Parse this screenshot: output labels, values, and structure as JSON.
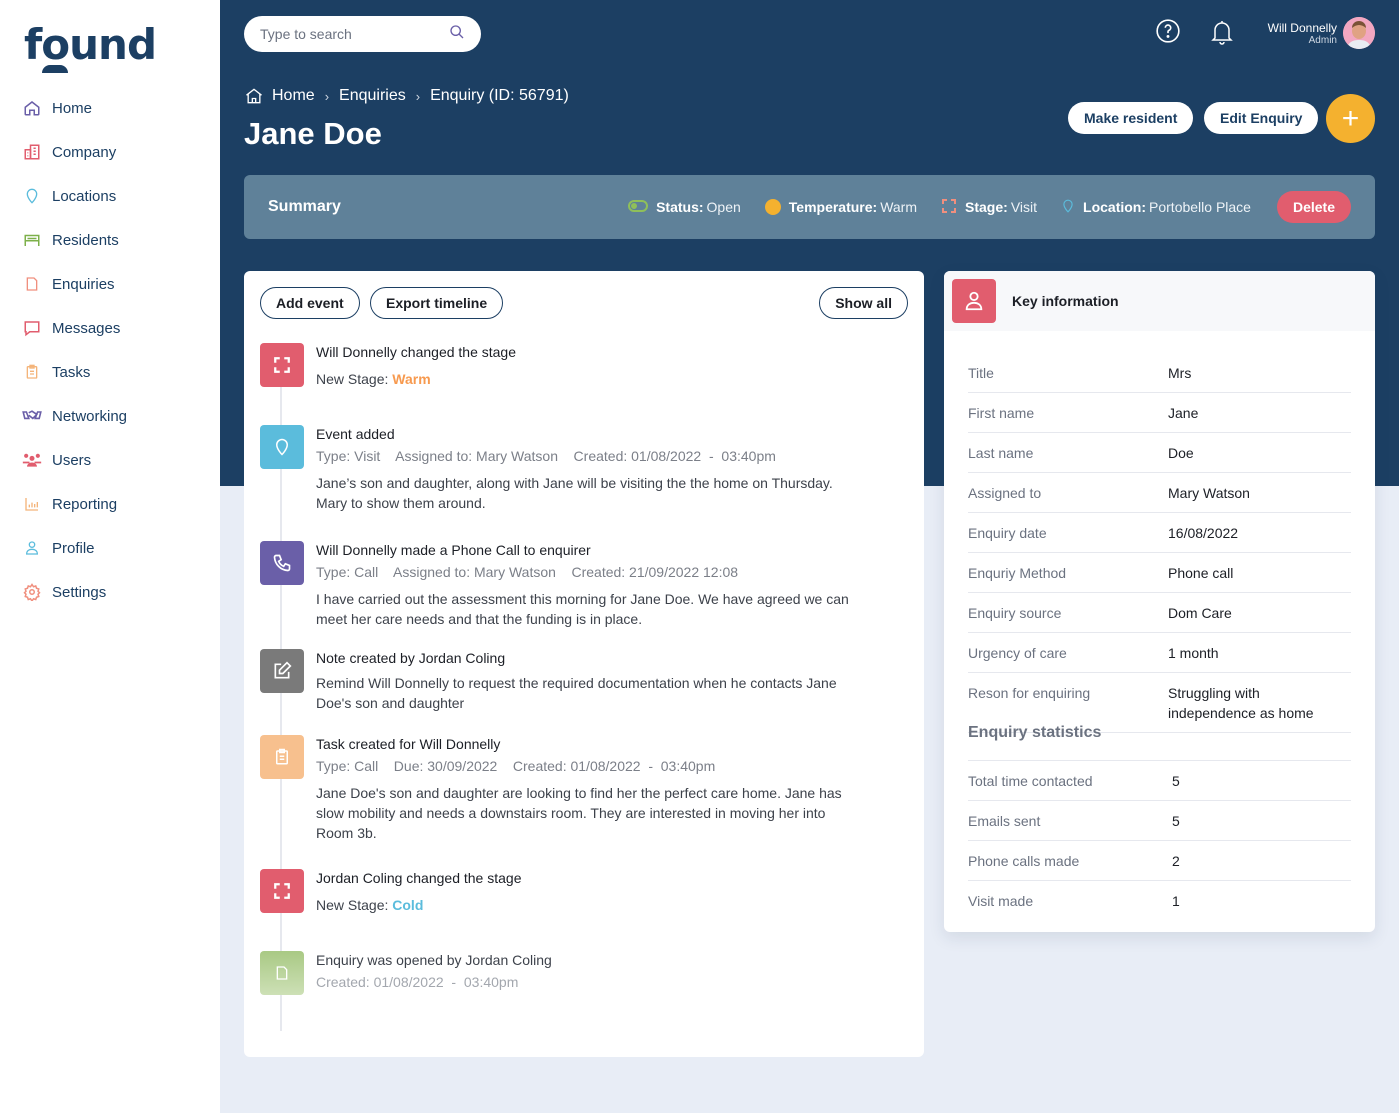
{
  "app": {
    "logo": "found"
  },
  "sidebar": {
    "items": [
      {
        "label": "Home",
        "icon": "home-icon",
        "color": "#6a5fa8"
      },
      {
        "label": "Company",
        "icon": "building-icon",
        "color": "#e15d6e"
      },
      {
        "label": "Locations",
        "icon": "location-pin-icon",
        "color": "#5bbcdc"
      },
      {
        "label": "Residents",
        "icon": "bed-icon",
        "color": "#7db04a"
      },
      {
        "label": "Enquiries",
        "icon": "document-icon",
        "color": "#f08f7e"
      },
      {
        "label": "Messages",
        "icon": "message-icon",
        "color": "#e15d6e"
      },
      {
        "label": "Tasks",
        "icon": "clipboard-icon",
        "color": "#f4b47a"
      },
      {
        "label": "Networking",
        "icon": "handshake-icon",
        "color": "#6a5fa8"
      },
      {
        "label": "Users",
        "icon": "users-icon",
        "color": "#e15d6e"
      },
      {
        "label": "Reporting",
        "icon": "bar-chart-icon",
        "color": "#f4b47a"
      },
      {
        "label": "Profile",
        "icon": "user-icon",
        "color": "#5bbcdc"
      },
      {
        "label": "Settings",
        "icon": "gear-icon",
        "color": "#f08f7e"
      }
    ]
  },
  "header": {
    "search": {
      "placeholder": "Type to search",
      "value": ""
    },
    "user": {
      "name": "Will Donnelly",
      "role": "Admin"
    },
    "breadcrumb": [
      "Home",
      "Enquiries",
      "Enquiry (ID: 56791)"
    ],
    "title": "Jane Doe",
    "actions": {
      "make_resident": "Make resident",
      "edit_enquiry": "Edit Enquiry",
      "add": "+"
    }
  },
  "summary": {
    "title": "Summary",
    "status": {
      "label": "Status:",
      "value": "Open"
    },
    "temperature": {
      "label": "Temperature:",
      "value": "Warm",
      "color": "#f4b12f"
    },
    "stage": {
      "label": "Stage:",
      "value": "Visit"
    },
    "location": {
      "label": "Location:",
      "value": "Portobello Place"
    },
    "delete_label": "Delete"
  },
  "timeline": {
    "buttons": {
      "add_event": "Add event",
      "export": "Export timeline",
      "show_all": "Show all"
    },
    "items": [
      {
        "type": "stage",
        "title": "Will Donnelly changed the stage",
        "stage_label": "New Stage:",
        "stage_value": "Warm",
        "stage_color": "#f79a4f",
        "icon_color": "#e15d6e"
      },
      {
        "type": "event",
        "title": "Event added",
        "meta": "Type: Visit    Assigned to: Mary Watson    Created: 01/08/2022  -  03:40pm",
        "desc": "Jane’s son and daughter, along with Jane will be visiting the the home on Thursday. Mary to show them around.",
        "icon_color": "#5bbcdc"
      },
      {
        "type": "call",
        "title": "Will Donnelly made a Phone Call to enquirer",
        "meta": "Type: Call    Assigned to: Mary Watson    Created: 21/09/2022 12:08",
        "desc": "I have carried out the assessment this morning for Jane Doe. We have agreed we can meet her care needs and that the funding is in place.",
        "icon_color": "#6a5fa8"
      },
      {
        "type": "note",
        "title": "Note created by Jordan Coling",
        "desc": "Remind Will Donnelly to request the required documentation when he contacts Jane Doe's son and daughter",
        "icon_color": "#7a7a7a"
      },
      {
        "type": "task",
        "title": "Task created for Will Donnelly",
        "meta": "Type: Call    Due: 30/09/2022    Created: 01/08/2022  -  03:40pm",
        "desc": "Jane Doe's son and daughter are looking to find her the perfect care home. Jane has slow mobility and needs a downstairs room. They are interested in moving her into Room 3b.",
        "icon_color": "#f7c08e"
      },
      {
        "type": "stage",
        "title": "Jordan Coling changed the stage",
        "stage_label": "New Stage:",
        "stage_value": "Cold",
        "stage_color": "#5bbcdc",
        "icon_color": "#e15d6e"
      },
      {
        "type": "opened",
        "title": "Enquiry was opened by Jordan Coling",
        "meta": "Created: 01/08/2022  -  03:40pm",
        "icon_color": "#a9c984"
      }
    ]
  },
  "key_info": {
    "title": "Key information",
    "rows": [
      {
        "label": "Title",
        "value": "Mrs"
      },
      {
        "label": "First name",
        "value": "Jane"
      },
      {
        "label": "Last name",
        "value": "Doe"
      },
      {
        "label": "Assigned to",
        "value": "Mary Watson"
      },
      {
        "label": "Enquiry date",
        "value": "16/08/2022"
      },
      {
        "label": "Enquriy Method",
        "value": "Phone call"
      },
      {
        "label": "Enquiry source",
        "value": "Dom Care"
      },
      {
        "label": "Urgency of care",
        "value": "1 month"
      },
      {
        "label": "Reson for enquiring",
        "value": "Struggling with independence as home"
      }
    ],
    "stats_title": "Enquiry statistics",
    "stats": [
      {
        "label": "Total time contacted",
        "value": "5"
      },
      {
        "label": "Emails sent",
        "value": "5"
      },
      {
        "label": "Phone calls made",
        "value": "2"
      },
      {
        "label": "Visit made",
        "value": "1"
      }
    ]
  }
}
